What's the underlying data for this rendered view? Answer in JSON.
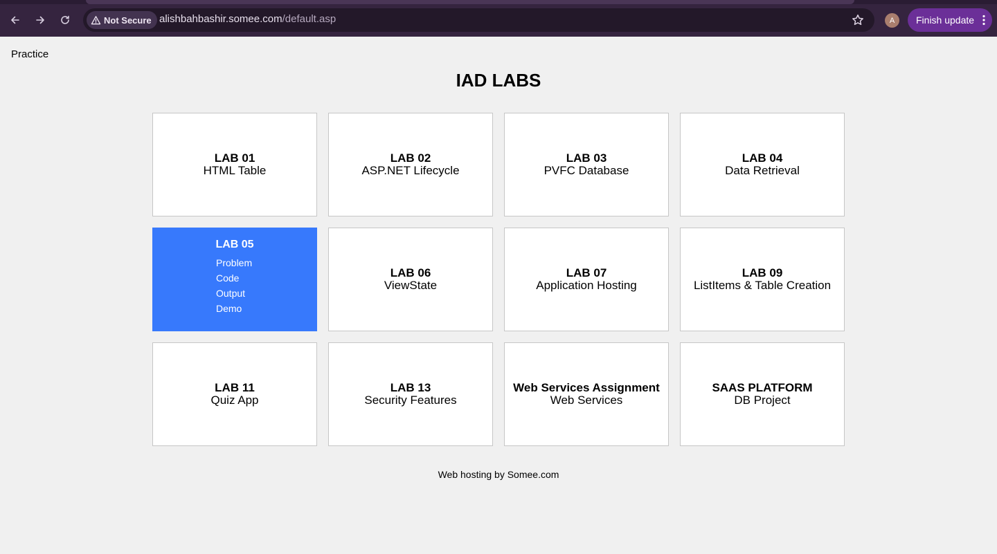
{
  "browser": {
    "security_label": "Not Secure",
    "url_host": "alishbahbashir.somee.com",
    "url_path": "/default.asp",
    "avatar_letter": "A",
    "update_label": "Finish update"
  },
  "page": {
    "practice_link": "Practice",
    "title": "IAD LABS",
    "footer": "Web hosting by Somee.com"
  },
  "labs": [
    {
      "title": "LAB 01",
      "subtitle": "HTML Table"
    },
    {
      "title": "LAB 02",
      "subtitle": "ASP.NET Lifecycle"
    },
    {
      "title": "LAB 03",
      "subtitle": "PVFC Database"
    },
    {
      "title": "LAB 04",
      "subtitle": "Data Retrieval"
    },
    {
      "title": "LAB 05",
      "menu": [
        "Problem",
        "Code",
        "Output",
        "Demo"
      ]
    },
    {
      "title": "LAB 06",
      "subtitle": "ViewState"
    },
    {
      "title": "LAB 07",
      "subtitle": "Application Hosting"
    },
    {
      "title": "LAB 09",
      "subtitle": "ListItems & Table Creation"
    },
    {
      "title": "LAB 11",
      "subtitle": "Quiz App"
    },
    {
      "title": "LAB 13",
      "subtitle": "Security Features"
    },
    {
      "title": "Web Services Assignment",
      "subtitle": "Web Services"
    },
    {
      "title": "SAAS PLATFORM",
      "subtitle": "DB Project"
    }
  ],
  "colors": {
    "active_card": "#3779fc",
    "chrome_bg": "#35243f",
    "update_button": "#6b2f98"
  }
}
